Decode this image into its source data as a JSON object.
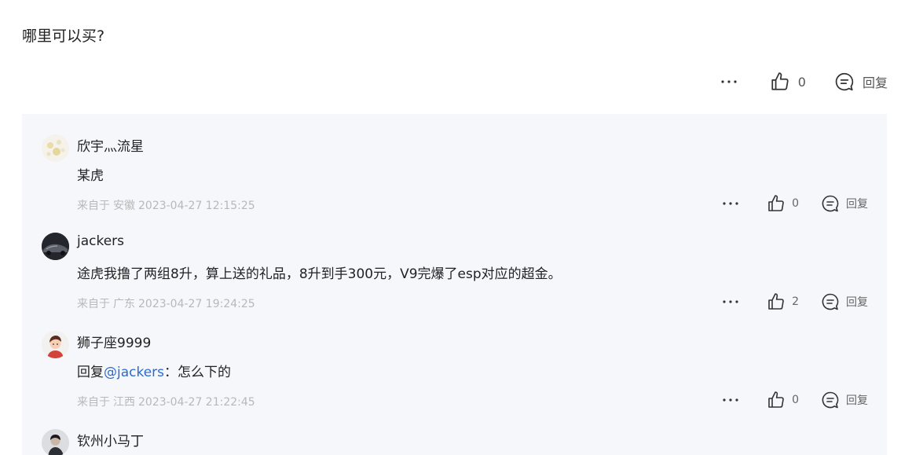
{
  "question": {
    "text": "哪里可以买?"
  },
  "top_actions": {
    "like_count": "0",
    "reply_label": "回复"
  },
  "replies": [
    {
      "username": "欣宇灬流星",
      "content_prefix": "",
      "mention": "",
      "content": "某虎",
      "source": "来自于",
      "location": "安徽",
      "time": "2023-04-27 12:15:25",
      "like_count": "0",
      "reply_label": "回复"
    },
    {
      "username": "jackers",
      "content_prefix": "",
      "mention": "",
      "content": "途虎我撸了两组8升，算上送的礼品，8升到手300元，V9完爆了esp对应的超金。",
      "source": "来自于",
      "location": "广东",
      "time": "2023-04-27 19:24:25",
      "like_count": "2",
      "reply_label": "回复"
    },
    {
      "username": "狮子座9999",
      "content_prefix": "回复",
      "mention": "@jackers",
      "content": "：怎么下的",
      "source": "来自于",
      "location": "江西",
      "time": "2023-04-27 21:22:45",
      "like_count": "0",
      "reply_label": "回复"
    },
    {
      "username": "钦州小马丁"
    }
  ],
  "colors": {
    "background": "#ffffff",
    "replies_background": "#f6f7fa",
    "mention": "#2a6ad3",
    "meta_text": "#b8b8b8",
    "icon": "#333333"
  }
}
